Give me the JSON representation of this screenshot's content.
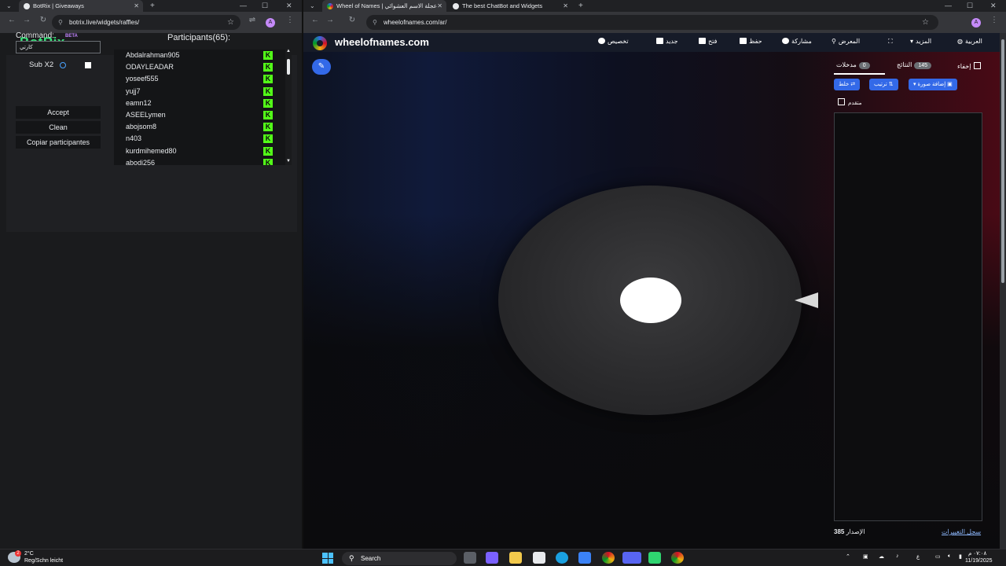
{
  "left_window": {
    "tab_title": "BotRix | Giveaways",
    "url": "botrix.live/widgets/raffles/",
    "profile_initial": "A"
  },
  "botrix": {
    "logo": "BotRix",
    "beta": "BETA",
    "command_label": "Command:",
    "command_value": "كارتي",
    "sub_label": "Sub X2",
    "accept": "Accept",
    "clean": "Clean",
    "copy_participants": "Copiar participantes",
    "participants_title": "Participants(65):",
    "participants": [
      "Abdalrahman905",
      "ODAYLEADAR",
      "yoseef555",
      "yujj7",
      "eamn12",
      "ASEELymen",
      "abojsom8",
      "n403",
      "kurdmihemed80",
      "abodi256"
    ],
    "platform_badge": "K"
  },
  "right_window": {
    "tabs": [
      {
        "title": "Wheel of Names | عجلة الاسم العشوائي"
      },
      {
        "title": "The best ChatBot and Widgets"
      }
    ],
    "url": "wheelofnames.com/ar/",
    "profile_initial": "A"
  },
  "wheel": {
    "site_title": "wheelofnames.com",
    "menu": {
      "language": "العربية",
      "more": "المزيد",
      "gallery": "المعرض",
      "share": "مشاركة",
      "save": "حفظ",
      "open": "فتح",
      "new": "جديد",
      "customize": "تخصيص"
    },
    "panel": {
      "hide": "إخفاء",
      "results_label": "النتائج",
      "results_count": "145",
      "entries_label": "مدخلات",
      "entries_count": "0",
      "add_image": "إضافة صورة",
      "sort": "ترتيب",
      "shuffle": "خلط",
      "advanced": "متقدم",
      "version_label": "الإصدار",
      "version": "385",
      "changelog": "سجل التغييرات"
    }
  },
  "taskbar": {
    "temperature": "2°C",
    "weather_desc": "Reg/Schn leicht",
    "search": "Search",
    "weather_badge": "2",
    "language": "ع",
    "time": "٠٧:٠٨ م",
    "date": "11/19/2025"
  }
}
